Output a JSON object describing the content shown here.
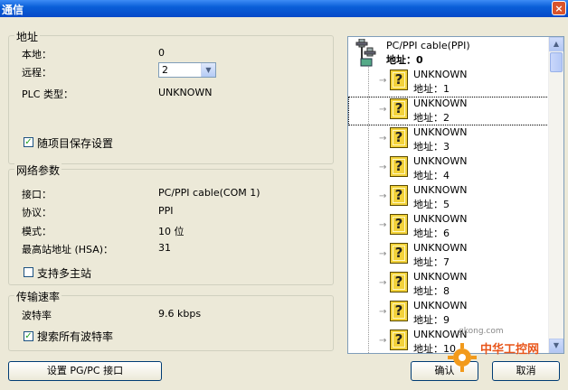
{
  "window": {
    "title": "通信",
    "close": "×"
  },
  "address_group": {
    "legend": "地址",
    "local_label": "本地：",
    "local_value": "0",
    "remote_label": "远程：",
    "remote_value": "2",
    "plc_type_label": "PLC 类型：",
    "plc_type_value": "UNKNOWN",
    "save_with_project_label": "随项目保存设置",
    "save_with_project_checked": true
  },
  "network_group": {
    "legend": "网络参数",
    "interface_label": "接口：",
    "interface_value": "PC/PPI cable(COM 1)",
    "protocol_label": "协议：",
    "protocol_value": "PPI",
    "mode_label": "模式：",
    "mode_value": "10 位",
    "hsa_label": "最高站地址 (HSA)：",
    "hsa_value": "31",
    "multimaster_label": "支持多主站",
    "multimaster_checked": false
  },
  "rate_group": {
    "legend": "传输速率",
    "baud_label": "波特率",
    "baud_value": "9.6 kbps",
    "search_all_label": "搜索所有波特率",
    "search_all_checked": true
  },
  "buttons": {
    "set_pgpc": "设置 PG/PC 接口",
    "ok": "确认",
    "cancel": "取消"
  },
  "tree": {
    "root_name": "PC/PPI cable(PPI)",
    "root_addr": "地址：0",
    "nodes": [
      {
        "name": "UNKNOWN",
        "addr": "地址：1"
      },
      {
        "name": "UNKNOWN",
        "addr": "地址：2"
      },
      {
        "name": "UNKNOWN",
        "addr": "地址：3"
      },
      {
        "name": "UNKNOWN",
        "addr": "地址：4"
      },
      {
        "name": "UNKNOWN",
        "addr": "地址：5"
      },
      {
        "name": "UNKNOWN",
        "addr": "地址：6"
      },
      {
        "name": "UNKNOWN",
        "addr": "地址：7"
      },
      {
        "name": "UNKNOWN",
        "addr": "地址：8"
      },
      {
        "name": "UNKNOWN",
        "addr": "地址：9"
      },
      {
        "name": "UNKNOWN",
        "addr": "地址：10"
      }
    ],
    "selected_index": 1
  },
  "watermark": {
    "text": "中华工控网",
    "url": "gkong.com"
  }
}
